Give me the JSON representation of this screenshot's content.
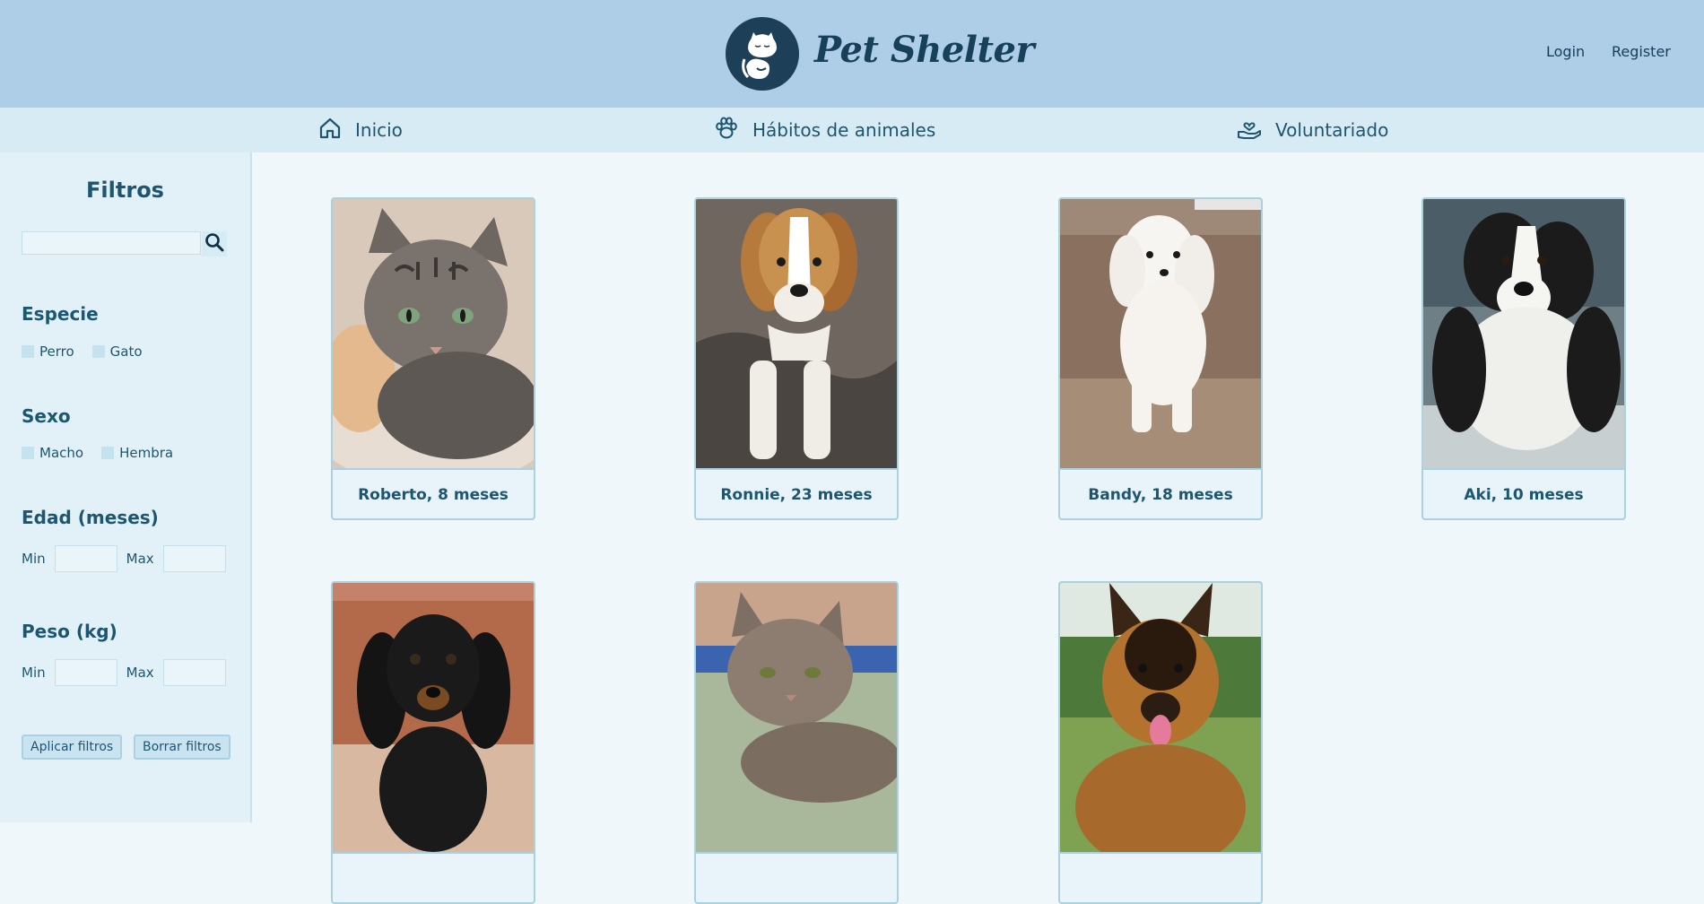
{
  "header": {
    "brand": "Pet Shelter",
    "login": "Login",
    "register": "Register"
  },
  "nav": {
    "items": [
      {
        "label": "Inicio",
        "icon": "home-icon"
      },
      {
        "label": "Hábitos de animales",
        "icon": "paw-icon"
      },
      {
        "label": "Voluntariado",
        "icon": "hand-heart-icon"
      }
    ]
  },
  "filters": {
    "title": "Filtros",
    "search": {
      "value": "",
      "placeholder": ""
    },
    "species": {
      "title": "Especie",
      "options": [
        "Perro",
        "Gato"
      ]
    },
    "sex": {
      "title": "Sexo",
      "options": [
        "Macho",
        "Hembra"
      ]
    },
    "age": {
      "title": "Edad (meses)",
      "min_label": "Min",
      "max_label": "Max"
    },
    "weight": {
      "title": "Peso (kg)",
      "min_label": "Min",
      "max_label": "Max"
    },
    "apply": "Aplicar filtros",
    "clear": "Borrar filtros"
  },
  "pets": [
    {
      "caption": "Roberto, 8 meses",
      "species": "cat"
    },
    {
      "caption": "Ronnie, 23 meses",
      "species": "dog"
    },
    {
      "caption": "Bandy, 18 meses",
      "species": "dog"
    },
    {
      "caption": "Aki, 10 meses",
      "species": "dog"
    },
    {
      "caption": "",
      "species": "dog"
    },
    {
      "caption": "",
      "species": "cat"
    },
    {
      "caption": "",
      "species": "dog"
    }
  ],
  "colors": {
    "header_bg": "#aecde6",
    "nav_bg": "#d7ebf5",
    "sidebar_bg": "#e2f1f8",
    "content_bg": "#f0f7fb",
    "accent": "#1d5670"
  }
}
